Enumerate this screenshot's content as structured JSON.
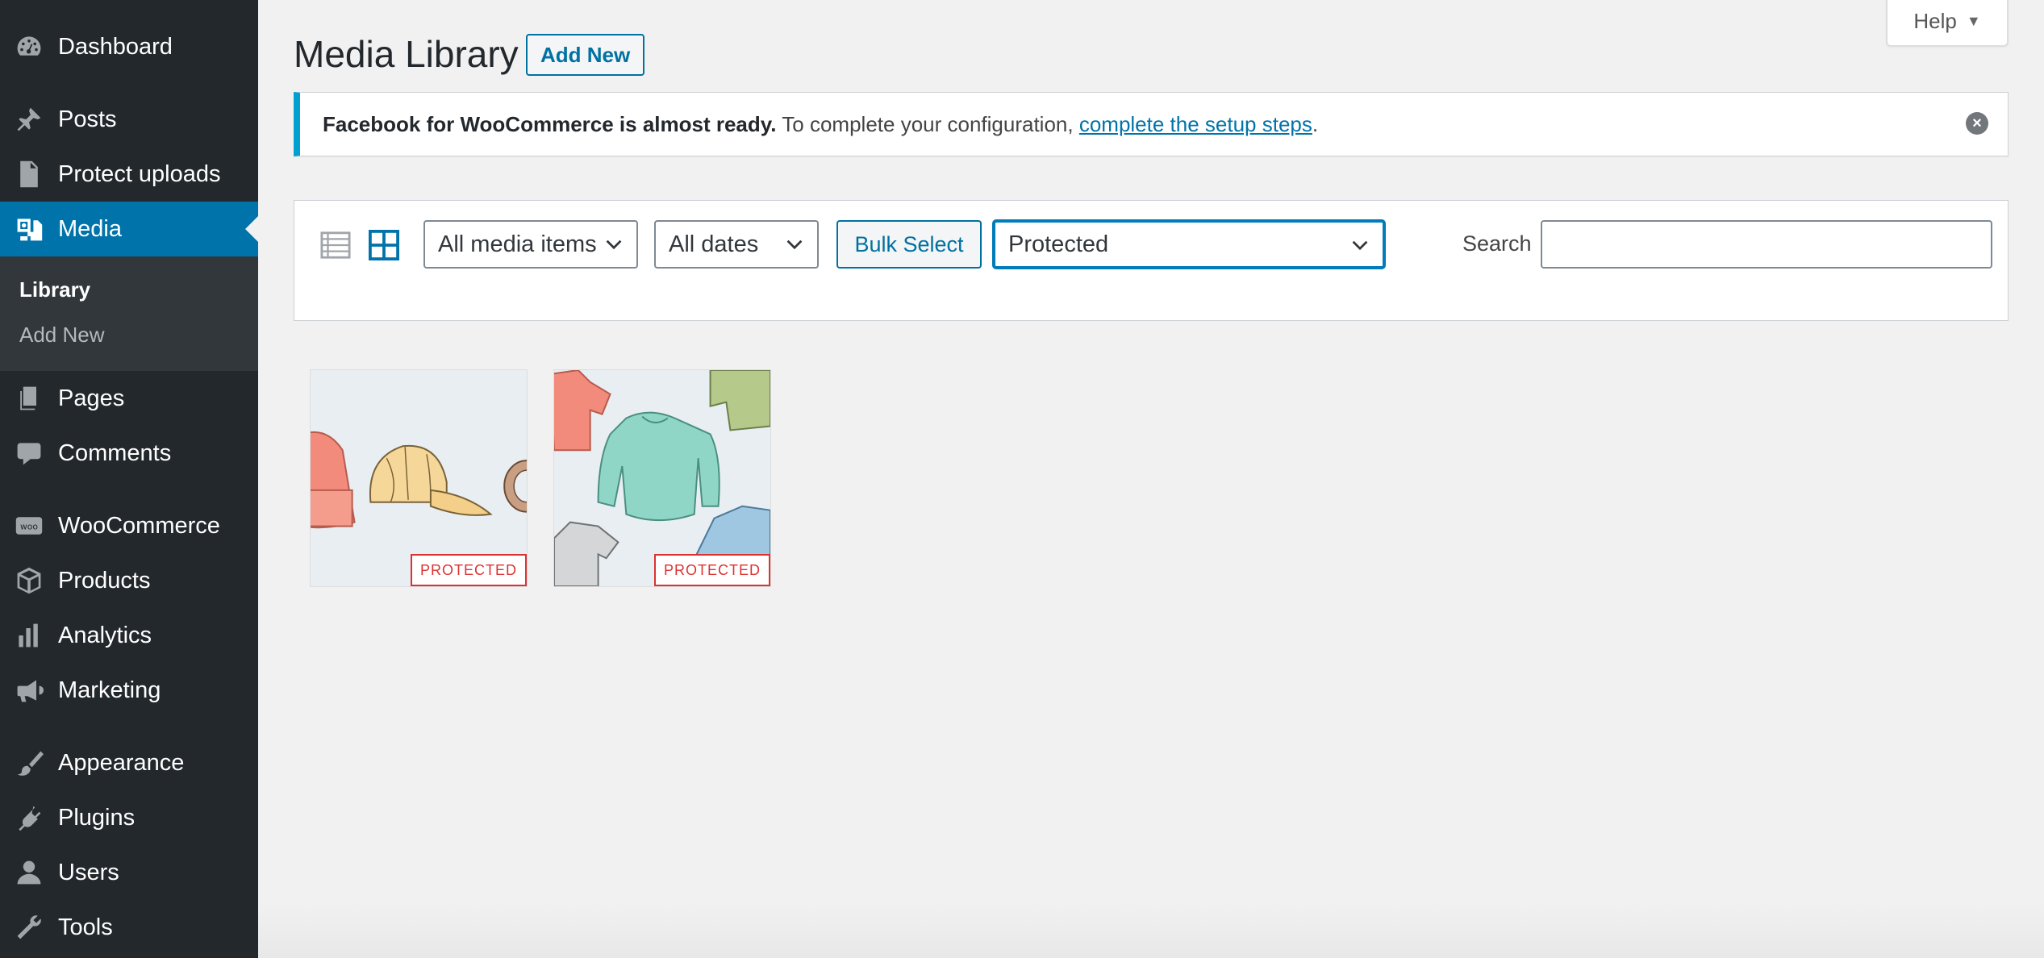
{
  "sidebar": {
    "items": [
      {
        "label": "Dashboard",
        "icon": "dashboard-icon"
      },
      {
        "label": "Posts",
        "icon": "pin-icon"
      },
      {
        "label": "Protect uploads",
        "icon": "lock-file-icon"
      },
      {
        "label": "Media",
        "icon": "media-icon",
        "active": true
      },
      {
        "label": "Pages",
        "icon": "pages-icon"
      },
      {
        "label": "Comments",
        "icon": "comment-icon"
      },
      {
        "label": "WooCommerce",
        "icon": "woo-icon"
      },
      {
        "label": "Products",
        "icon": "box-icon"
      },
      {
        "label": "Analytics",
        "icon": "bar-chart-icon"
      },
      {
        "label": "Marketing",
        "icon": "megaphone-icon"
      },
      {
        "label": "Appearance",
        "icon": "brush-icon"
      },
      {
        "label": "Plugins",
        "icon": "plug-icon"
      },
      {
        "label": "Users",
        "icon": "user-icon"
      },
      {
        "label": "Tools",
        "icon": "wrench-icon"
      }
    ],
    "submenu": [
      {
        "label": "Library",
        "current": true
      },
      {
        "label": "Add New"
      }
    ]
  },
  "header": {
    "help_label": "Help",
    "title": "Media Library",
    "add_new_label": "Add New"
  },
  "notice": {
    "strong": "Facebook for WooCommerce is almost ready.",
    "text": " To complete your configuration, ",
    "link": "complete the setup steps",
    "end": "."
  },
  "toolbar": {
    "type_filter": "All media items",
    "date_filter": "All dates",
    "bulk_select_label": "Bulk Select",
    "protection_filter": "Protected",
    "search_label": "Search",
    "search_value": ""
  },
  "attachments": [
    {
      "name": "hats-image",
      "badge": "PROTECTED"
    },
    {
      "name": "shirts-image",
      "badge": "PROTECTED"
    }
  ],
  "colors": {
    "sidebar_bg": "#23282d",
    "active_bg": "#0073aa",
    "notice_accent": "#00a0d2",
    "badge_red": "#dc3232",
    "button_blue": "#0071a1"
  }
}
